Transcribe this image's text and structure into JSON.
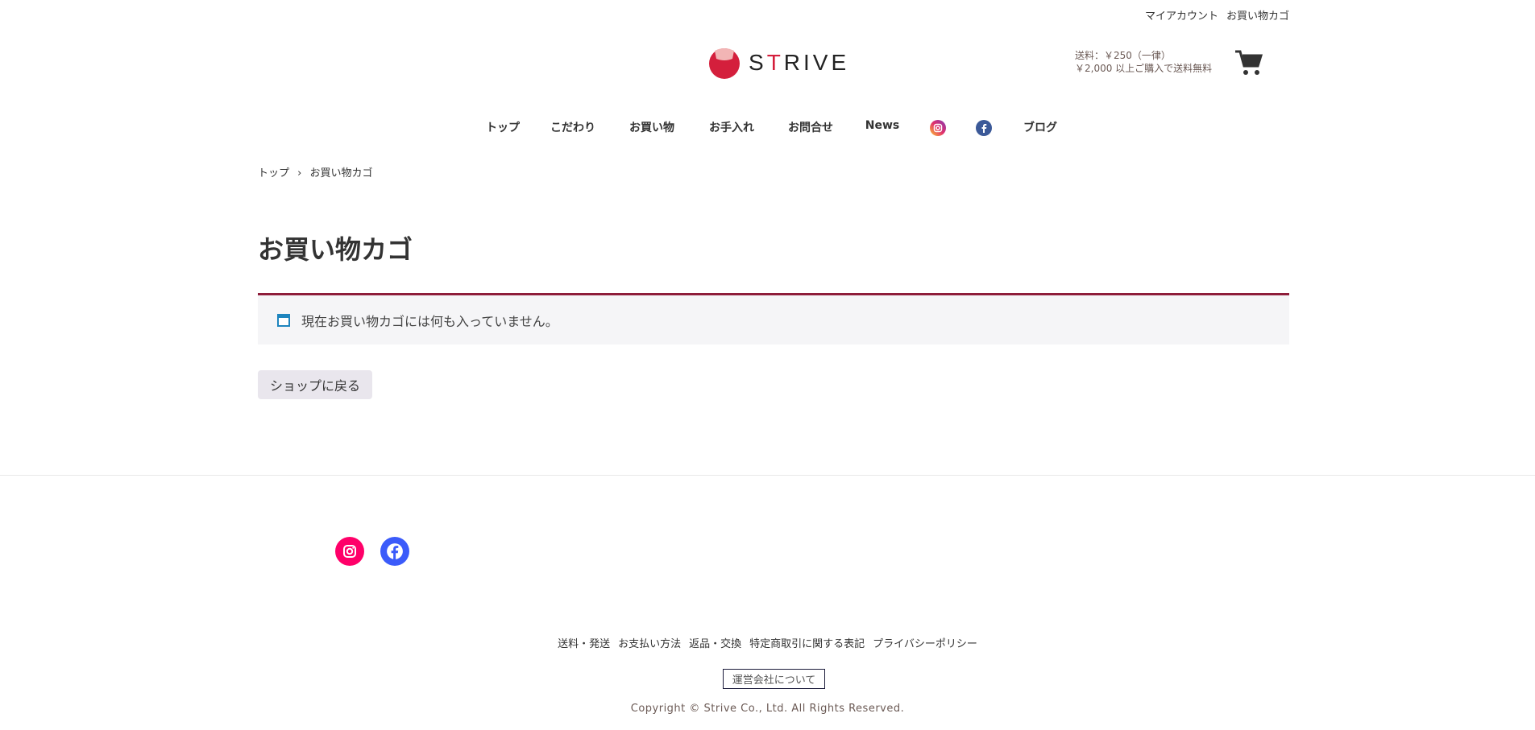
{
  "header": {
    "top_links": [
      "マイアカウント",
      "お買い物カゴ"
    ],
    "logo_text_pre": "S",
    "logo_text_accent": "T",
    "logo_text_post": "RIVE",
    "shipping_line1": "送料：￥250（一律）",
    "shipping_line2": "￥2,000 以上ご購入で送料無料",
    "cart_icon": "cart-icon"
  },
  "nav": {
    "items": [
      "トップ",
      "こだわり",
      "お買い物",
      "お手入れ",
      "お問合せ",
      "News",
      "ブログ"
    ],
    "icons": [
      "instagram-icon",
      "facebook-icon"
    ]
  },
  "breadcrumb": {
    "home": "トップ",
    "separator": "›",
    "current": "お買い物カゴ"
  },
  "main": {
    "title": "お買い物カゴ",
    "notice": "現在お買い物カゴには何も入っていません。",
    "back_button": "ショップに戻る"
  },
  "footer": {
    "links": [
      "送料・発送",
      "お支払い方法",
      "返品・交換",
      "特定商取引に関する表記",
      "プライバシーポリシー"
    ],
    "company": "運営会社について",
    "copyright": "Copyright © Strive Co., Ltd. All Rights Reserved."
  },
  "colors": {
    "accent": "#8e1d3a",
    "brand": "#d41f3c",
    "instagram": "#ff0069",
    "facebook": "#3b5bfa"
  }
}
